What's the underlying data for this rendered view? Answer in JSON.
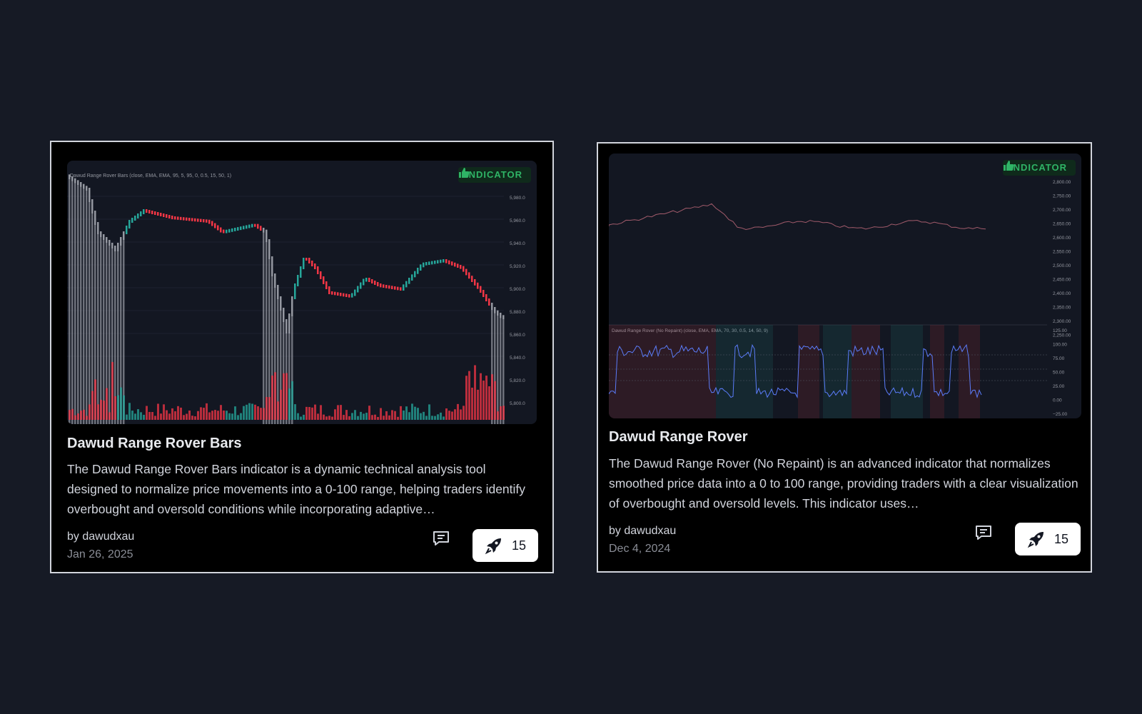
{
  "colors": {
    "page_bg": "#161a25",
    "card_bg": "#000000",
    "card_border": "#d1d4dc",
    "badge_green": "#2fb466",
    "candle_up": "#26a69a",
    "candle_down": "#f23645",
    "neutral_bar": "#9598a1",
    "osc_line": "#5b7cfa"
  },
  "cards": [
    {
      "badge_label": "INDICATOR",
      "badge_icon": "thumbs-up-icon",
      "title": "Dawud Range Rover Bars",
      "description": "The Dawud Range Rover Bars indicator is a dynamic technical analysis tool designed to normalize price movements into a 0-100 range, helping traders identify overbought and oversold conditions while incorporating adaptive…",
      "author": "by dawudxau",
      "date": "Jan 26, 2025",
      "comment_icon": "comment-icon",
      "boost_icon": "rocket-icon",
      "boost_count": "15",
      "chart_legend": "Dawud Range Rover Bars (close, EMA, EMA, 95, 5, 95, 0, 0.5, 15, 50, 1)",
      "price_ticks": [
        "5,980.0",
        "5,960.0",
        "5,940.0",
        "5,920.0",
        "5,900.0",
        "5,880.0",
        "5,860.0",
        "5,840.0",
        "5,820.0",
        "5,800.0"
      ]
    },
    {
      "badge_label": "INDICATOR",
      "badge_icon": "thumbs-up-icon",
      "title": "Dawud Range Rover",
      "description": "The Dawud Range Rover (No Repaint) is an advanced indicator that normalizes smoothed price data into a 0 to 100 range, providing traders with a clear visualization of overbought and oversold levels. This indicator uses…",
      "author": "by dawudxau",
      "date": "Dec 4, 2024",
      "comment_icon": "comment-icon",
      "boost_icon": "rocket-icon",
      "boost_count": "15",
      "chart_legend": "Dawud Range Rover (No Repaint) (close, EMA, EMA, 70, 30, 0.5, 14, 50, 9)",
      "price_ticks": [
        "2,800.00",
        "2,750.00",
        "2,700.00",
        "2,650.00",
        "2,600.00",
        "2,550.00",
        "2,500.00",
        "2,450.00",
        "2,400.00",
        "2,350.00",
        "2,300.00",
        "2,250.00"
      ],
      "osc_ticks": [
        "125.00",
        "100.00",
        "75.00",
        "50.00",
        "25.00",
        "0.00",
        "−25.00"
      ]
    }
  ]
}
